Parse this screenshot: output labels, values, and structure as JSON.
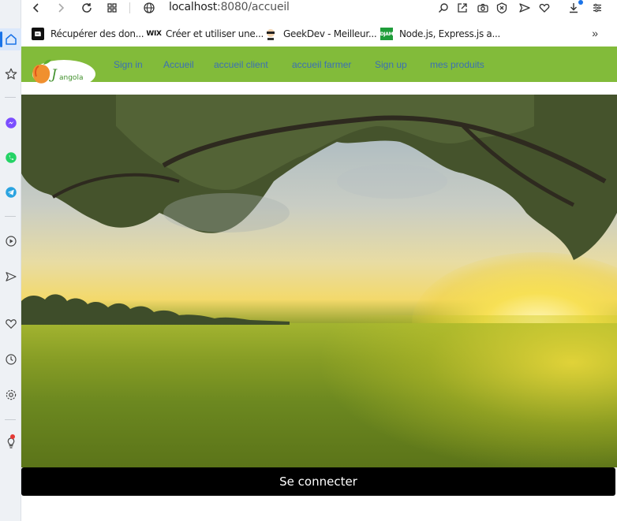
{
  "browser": {
    "url_host": "localhost",
    "url_path": ":8080/accueil",
    "bookmarks": [
      {
        "label": "Récupérer des don...",
        "icon": "page-icon"
      },
      {
        "label": "Créer et utiliser une...",
        "icon": "wix-icon",
        "fav_text": "WIX"
      },
      {
        "label": "GeekDev - Meilleur...",
        "icon": "geekdev-icon"
      },
      {
        "label": "Node.js, Express.js a...",
        "icon": "djam-icon",
        "fav_text": "DJAM"
      }
    ],
    "more_bookmarks": "»"
  },
  "navbar": {
    "logo_text": "Jangola",
    "links": [
      {
        "label": "Sign in"
      },
      {
        "label": "Accueil"
      },
      {
        "label": "accueil client"
      },
      {
        "label": "accueil farmer"
      },
      {
        "label": "Sign up"
      },
      {
        "label": "mes produits"
      }
    ]
  },
  "hero": {
    "image": "landscape-sunset-field-photo"
  },
  "connect_button": {
    "label": "Se connecter"
  },
  "colors": {
    "navbar": "#82bb3a",
    "nav_link": "#3b6fb6",
    "button": "#000000",
    "button_text": "#ffffff",
    "sidebar": "#eef1f5",
    "accent": "#1a73e8"
  }
}
